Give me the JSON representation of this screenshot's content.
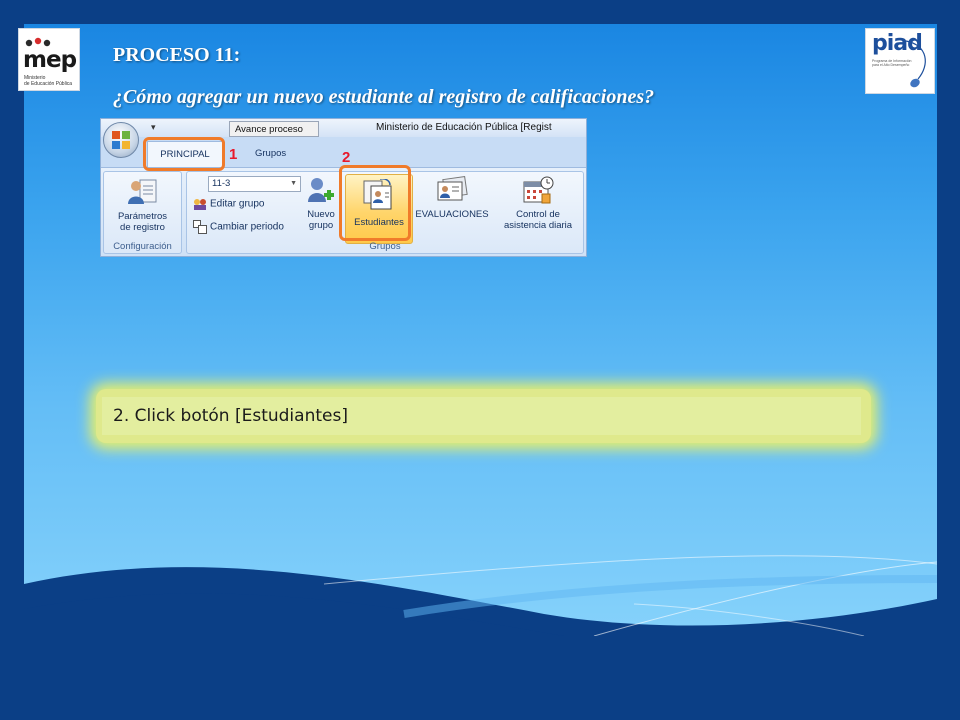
{
  "slide": {
    "title": "PROCESO 11:",
    "subtitle": "¿Cómo  agregar un nuevo estudiante al registro de calificaciones?"
  },
  "logos": {
    "mep": {
      "wordmark": "mep",
      "caption_line1": "Ministerio",
      "caption_line2": "de Educación Pública"
    },
    "piad": {
      "wordmark": "piad",
      "caption": "Programa de Información para el Alto Desempeño"
    }
  },
  "ribbon": {
    "context_tab": "Avance proceso",
    "window_title": "Ministerio de Educación Pública [Regist",
    "tabs": [
      {
        "label": "PRINCIPAL",
        "selected": true
      },
      {
        "label": "Grupos",
        "selected": false
      }
    ],
    "configuracion": {
      "label": "Configuración",
      "parametros_line1": "Parámetros",
      "parametros_line2": "de registro"
    },
    "grupos": {
      "label": "Grupos",
      "selected_group": "11-3",
      "editar_grupo": "Editar grupo",
      "cambiar_periodo": "Cambiar periodo",
      "nuevo_line1": "Nuevo",
      "nuevo_line2": "grupo",
      "estudiantes": "Estudiantes",
      "evaluaciones": "EVALUACIONES",
      "control_line1": "Control de",
      "control_line2": "asistencia diaria"
    }
  },
  "callouts": {
    "one": "1",
    "two": "2"
  },
  "instruction": "2. Click botón [Estudiantes]",
  "colors": {
    "highlight": "#f07b2a",
    "callout_number": "#e8192c",
    "panel_top": "#1a86e2",
    "panel_bottom": "#86d2fb",
    "outer": "#0b3f86"
  }
}
